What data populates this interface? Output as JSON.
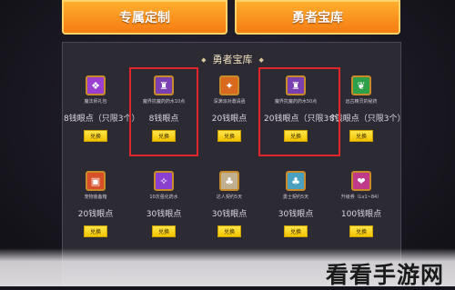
{
  "tabs": [
    {
      "label": "专属定制"
    },
    {
      "label": "勇者宝库"
    }
  ],
  "panel": {
    "title": "勇者宝库",
    "diamond": "◆"
  },
  "items": [
    {
      "name": "魔法师礼包",
      "price": "8钱眼点（只限3个）",
      "button": "兑换",
      "icon": "gift-icon",
      "color": "#9b3fd0"
    },
    {
      "name": "魔界抗魔药药水10点",
      "price": "8钱眼点",
      "button": "兑换",
      "icon": "potion-icon",
      "color": "#7a3fb0"
    },
    {
      "name": "深渊派对邀请函",
      "price": "20钱眼点",
      "button": "兑换",
      "icon": "ticket-icon",
      "color": "#d86a20"
    },
    {
      "name": "魔界抗魔药药水50点",
      "price": "20钱眼点（只限3个）",
      "button": "兑换",
      "icon": "potion-icon",
      "color": "#7a3fb0"
    },
    {
      "name": "远古精灵的秘药",
      "price": "8钱眼点（只限3个）",
      "button": "兑换",
      "icon": "elixir-icon",
      "color": "#2fa04a"
    },
    {
      "name": "宠物装备箱",
      "price": "20钱眼点",
      "button": "兑换",
      "icon": "chest-icon",
      "color": "#d8502a"
    },
    {
      "name": "10次强化药水",
      "price": "30钱眼点",
      "button": "兑换",
      "icon": "wand-icon",
      "color": "#8a3fd0"
    },
    {
      "name": "达人契约5天",
      "price": "30钱眼点",
      "button": "兑换",
      "icon": "scroll-icon",
      "color": "#c0b090"
    },
    {
      "name": "勇士契约5天",
      "price": "30钱眼点",
      "button": "兑换",
      "icon": "scroll-icon",
      "color": "#4aa0c0"
    },
    {
      "name": "升级券（Lv1~84）",
      "price": "100钱眼点",
      "button": "兑换",
      "icon": "coupon-icon",
      "color": "#c03a8a"
    }
  ],
  "watermark": "看看手游网"
}
